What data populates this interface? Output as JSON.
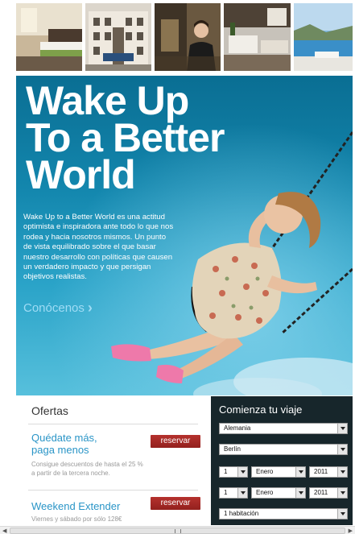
{
  "hero": {
    "title_lines": [
      "Wake Up",
      "To a Better",
      "World"
    ],
    "description": "Wake Up to a Better World es una actitud optimista e inspiradora ante todo lo que nos rodea y hacia nosotros mismos. Un punto de vista equilibrado sobre el que basar nuestro desarrollo con políticas que causen un verdadero impacto y que persigan objetivos realistas.",
    "cta_label": "Conócenos",
    "cta_icon": "chevron-right-icon"
  },
  "offers": {
    "title": "Ofertas",
    "items": [
      {
        "name_lines": [
          "Quédate más,",
          "paga menos"
        ],
        "description": "Consigue descuentos de hasta el 25 % a partir de la tercera noche.",
        "button_label": "reservar"
      },
      {
        "name_lines": [
          "Weekend Extender"
        ],
        "description": "Viernes y sábado por sólo 128€",
        "button_label": "reservar"
      }
    ]
  },
  "booking": {
    "title": "Comienza tu viaje",
    "country": "Alemania",
    "city": "Berlín",
    "checkin": {
      "day": "1",
      "month": "Enero",
      "year": "2011"
    },
    "checkout": {
      "day": "1",
      "month": "Enero",
      "year": "2011"
    },
    "rooms": "1 habitación"
  },
  "colors": {
    "hero_blue": "#1386ad",
    "offer_link": "#2a95c7",
    "button_red": "#a62a26",
    "booking_bg": "#17262b"
  }
}
